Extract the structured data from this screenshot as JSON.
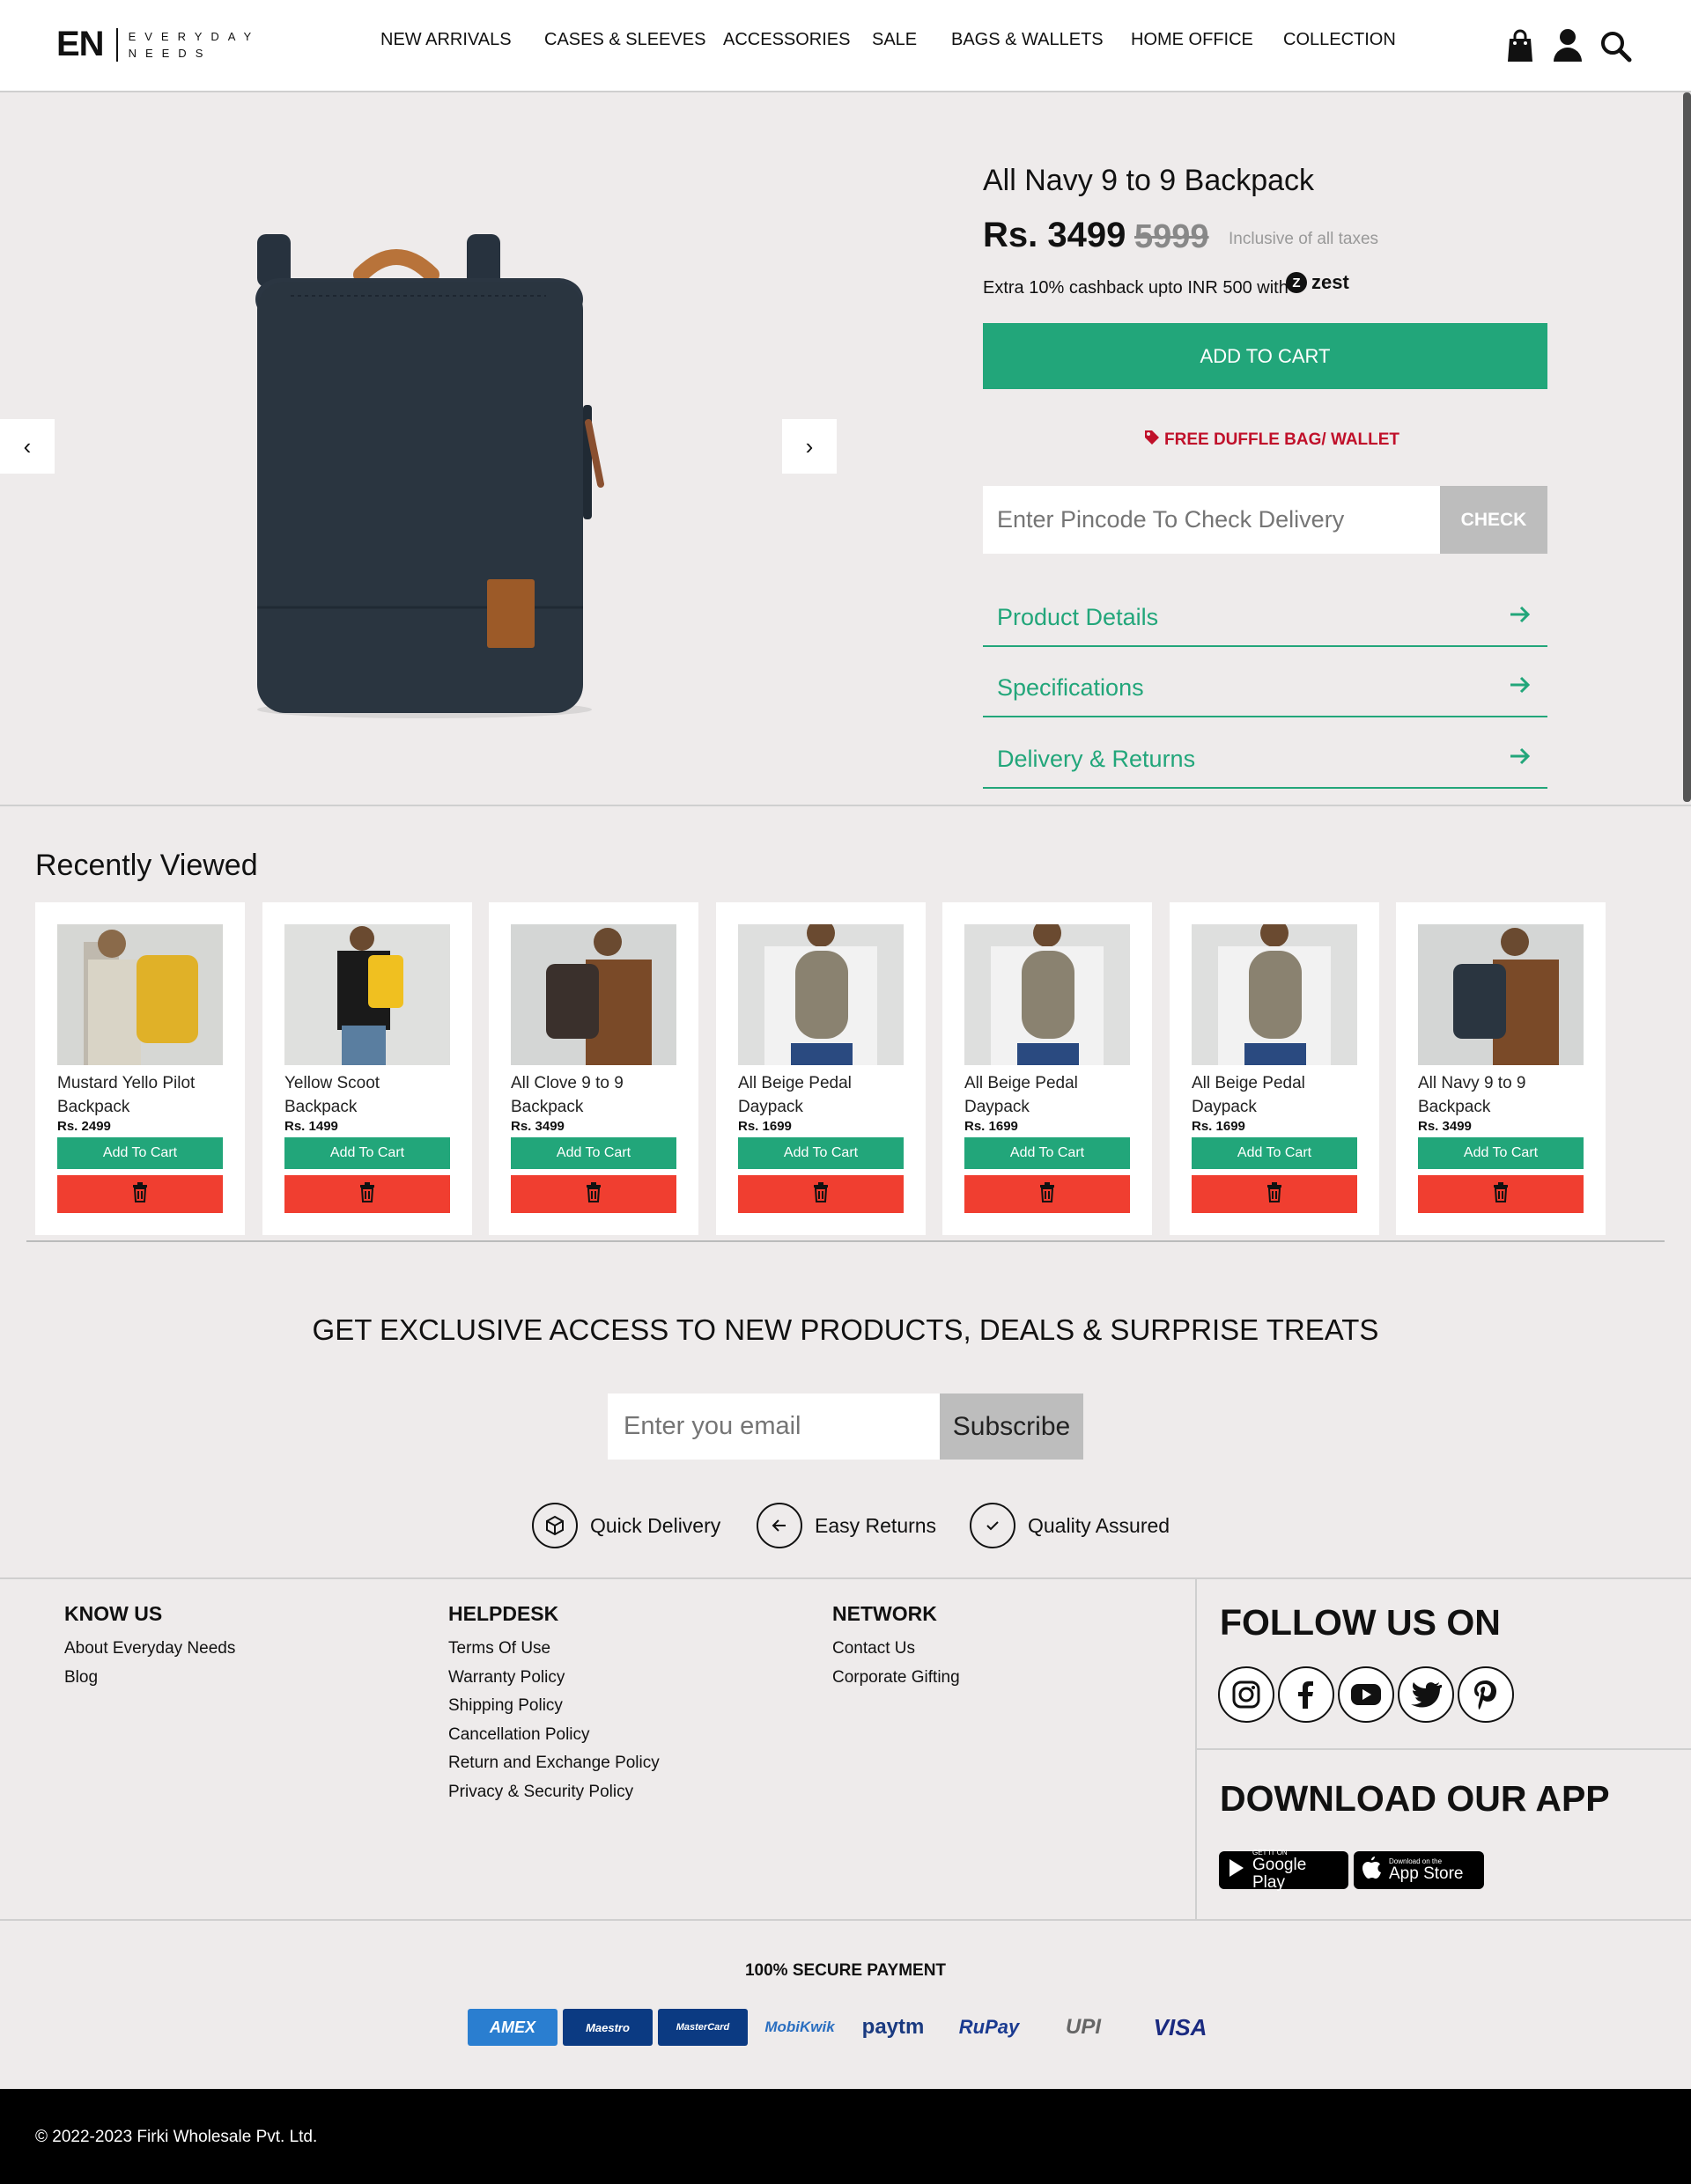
{
  "brand": {
    "logo_short": "EN",
    "logo_line1": "EVERYDAY",
    "logo_line2": "NEEDS"
  },
  "nav": [
    "NEW ARRIVALS",
    "CASES & SLEEVES",
    "ACCESSORIES",
    "SALE",
    "BAGS & WALLETS",
    "HOME OFFICE",
    "COLLECTION"
  ],
  "header_icons": [
    "shopping-bag-icon",
    "user-icon",
    "search-icon"
  ],
  "carousel": {
    "prev": "‹",
    "next": "›"
  },
  "product": {
    "title": "All Navy 9 to 9 Backpack",
    "price": "Rs. 3499",
    "mrp": "5999",
    "tax_note": "Inclusive of all taxes",
    "cashback": "Extra 10% cashback upto INR 500 with",
    "zest": "zest",
    "add_to_cart": "ADD TO CART",
    "offer": "FREE DUFFLE BAG/ WALLET",
    "pincode_placeholder": "Enter Pincode To Check Delivery",
    "check": "CHECK",
    "accordions": [
      "Product Details",
      "Specifications",
      "Delivery & Returns"
    ]
  },
  "recently_viewed": {
    "title": "Recently Viewed",
    "cart_label": "Add To Cart",
    "items": [
      {
        "name": "Mustard Yello Pilot Backpack",
        "price": "Rs. 2499"
      },
      {
        "name": "Yellow Scoot Backpack",
        "price": "Rs. 1499"
      },
      {
        "name": "All Clove 9 to 9 Backpack",
        "price": "Rs. 3499"
      },
      {
        "name": "All Beige Pedal Daypack",
        "price": "Rs. 1699"
      },
      {
        "name": "All Beige Pedal Daypack",
        "price": "Rs. 1699"
      },
      {
        "name": "All Beige Pedal Daypack",
        "price": "Rs. 1699"
      },
      {
        "name": "All Navy 9 to 9 Backpack",
        "price": "Rs. 3499"
      }
    ]
  },
  "newsletter": {
    "title": "GET EXCLUSIVE ACCESS TO NEW PRODUCTS, DEALS & SURPRISE TREATS",
    "placeholder": "Enter you email",
    "button": "Subscribe"
  },
  "features": [
    "Quick Delivery",
    "Easy Returns",
    "Quality Assured"
  ],
  "footer": {
    "know_us": {
      "title": "KNOW US",
      "links": [
        "About Everyday Needs",
        "Blog"
      ]
    },
    "helpdesk": {
      "title": "HELPDESK",
      "links": [
        "Terms Of Use",
        "Warranty Policy",
        "Shipping Policy",
        "Cancellation Policy",
        "Return and Exchange Policy",
        "Privacy & Security Policy"
      ]
    },
    "network": {
      "title": "NETWORK",
      "links": [
        "Contact Us",
        "Corporate Gifting"
      ]
    },
    "follow": "FOLLOW US ON",
    "social": [
      "instagram-icon",
      "facebook-icon",
      "youtube-icon",
      "twitter-icon",
      "pinterest-icon"
    ],
    "download": "DOWNLOAD OUR APP",
    "google_small": "GET IT ON",
    "google_big": "Google Play",
    "apple_small": "Download on the",
    "apple_big": "App Store"
  },
  "payment": {
    "title": "100% SECURE PAYMENT",
    "methods": [
      "AMEX",
      "Maestro",
      "MasterCard",
      "MobiKwik",
      "paytm",
      "RuPay",
      "UPI",
      "VISA"
    ]
  },
  "copyright": "© 2022-2023 Firki Wholesale Pvt. Ltd.",
  "colors": {
    "accent": "#22a67a",
    "delete": "#f03e30",
    "offer": "#c0102a",
    "bg": "#eeebeb"
  }
}
